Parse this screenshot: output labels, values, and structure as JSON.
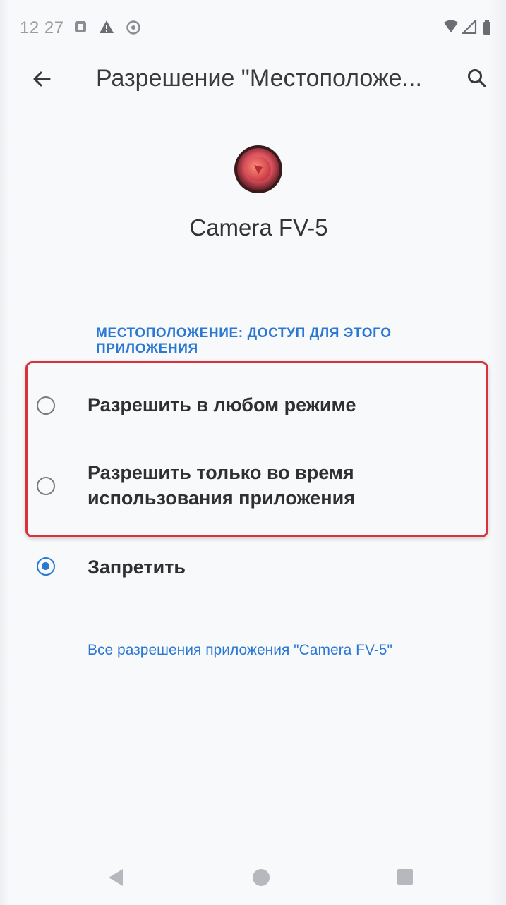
{
  "status_bar": {
    "time": "12 27",
    "icons": [
      "notification-icon",
      "warning-icon",
      "sync-icon",
      "wifi-icon",
      "signal-icon",
      "battery-icon"
    ]
  },
  "toolbar": {
    "title": "Разрешение \"Местоположе...",
    "back_icon": "arrow-left-icon",
    "search_icon": "search-icon"
  },
  "app": {
    "name": "Camera FV-5",
    "icon": "camera-lens-icon"
  },
  "section": {
    "header": "МЕСТОПОЛОЖЕНИЕ: ДОСТУП ДЛЯ ЭТОГО ПРИЛОЖЕНИЯ"
  },
  "options": [
    {
      "label": "Разрешить в любом режиме",
      "selected": false
    },
    {
      "label": "Разрешить только во время использования приложения",
      "selected": false
    },
    {
      "label": "Запретить",
      "selected": true
    }
  ],
  "link": {
    "all_permissions": "Все разрешения приложения \"Camera FV-5\""
  },
  "colors": {
    "accent": "#2a78d4",
    "highlight_border": "#d8323e",
    "background": "#f7f8fa"
  },
  "nav_bar": {
    "icons": [
      "nav-back-icon",
      "nav-home-icon",
      "nav-recents-icon"
    ]
  }
}
